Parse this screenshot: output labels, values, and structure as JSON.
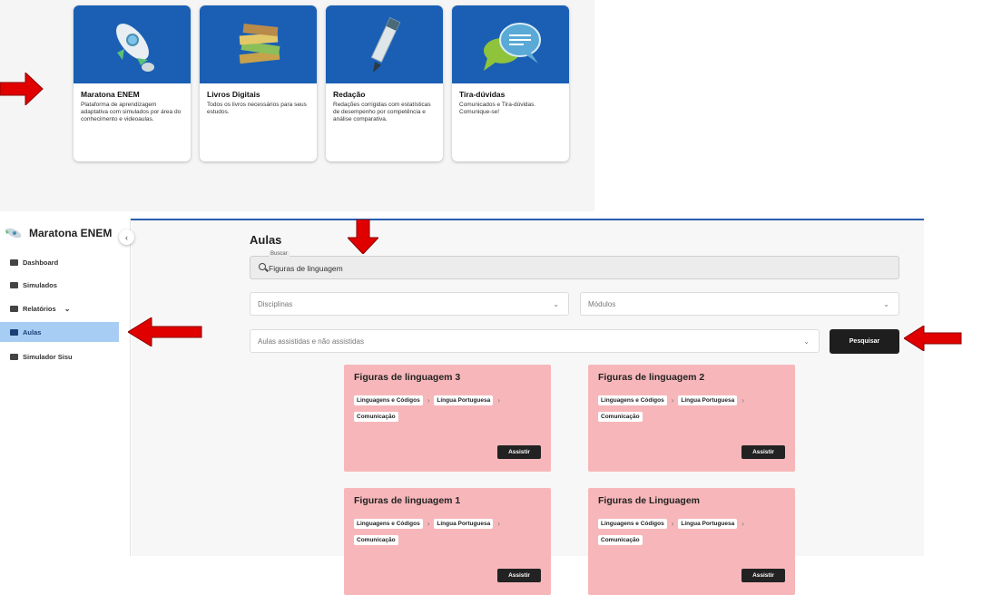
{
  "cards": [
    {
      "title": "Maratona ENEM",
      "desc": "Plataforma de aprendizagem adaptativa com simulados por área do conhecimento e videoaulas.",
      "icon": "rocket-icon"
    },
    {
      "title": "Livros Digitais",
      "desc": "Todos os livros necessários para seus estudos.",
      "icon": "books-icon"
    },
    {
      "title": "Redação",
      "desc": "Redações corrigidas com estatísticas de desempenho por competência e análise comparativa.",
      "icon": "pencil-icon"
    },
    {
      "title": "Tira-dúvidas",
      "desc": "Comunicados e Tira-dúvidas. Comunique-se!",
      "icon": "chat-bubbles-icon"
    }
  ],
  "sidebar": {
    "brand": "Maratona ENEM",
    "collapse": "‹",
    "items": [
      {
        "label": "Dashboard",
        "icon": "dashboard-icon"
      },
      {
        "label": "Simulados",
        "icon": "list-icon"
      },
      {
        "label": "Relatórios",
        "icon": "report-icon"
      },
      {
        "label": "Aulas",
        "icon": "video-icon"
      },
      {
        "label": "Simulador Sisu",
        "icon": "sisu-icon"
      }
    ]
  },
  "main": {
    "title": "Aulas",
    "search": {
      "label": "Buscar",
      "value": "Figuras de linguagem"
    },
    "filters": {
      "disciplinas": "Disciplinas",
      "modulos": "Módulos",
      "assistidas": "Aulas assistidas e não assistidas"
    },
    "search_button": "Pesquisar",
    "lessons": [
      {
        "title": "Figuras de linguagem 3",
        "crumbs": [
          "Linguagens e Códigos",
          "Língua Portuguesa",
          "Comunicação"
        ],
        "button": "Assistir"
      },
      {
        "title": "Figuras de linguagem 2",
        "crumbs": [
          "Linguagens e Códigos",
          "Língua Portuguesa",
          "Comunicação"
        ],
        "button": "Assistir"
      },
      {
        "title": "Figuras de linguagem 1",
        "crumbs": [
          "Linguagens e Códigos",
          "Língua Portuguesa",
          "Comunicação"
        ],
        "button": "Assistir"
      },
      {
        "title": "Figuras de Linguagem",
        "crumbs": [
          "Linguagens e Códigos",
          "Língua Portuguesa",
          "Comunicação"
        ],
        "button": "Assistir"
      }
    ]
  },
  "colors": {
    "card_image": "#1a5fb4",
    "active_nav": "#a7cdf5",
    "lesson_card": "#f7b7ba",
    "arrow": "#e00000"
  }
}
